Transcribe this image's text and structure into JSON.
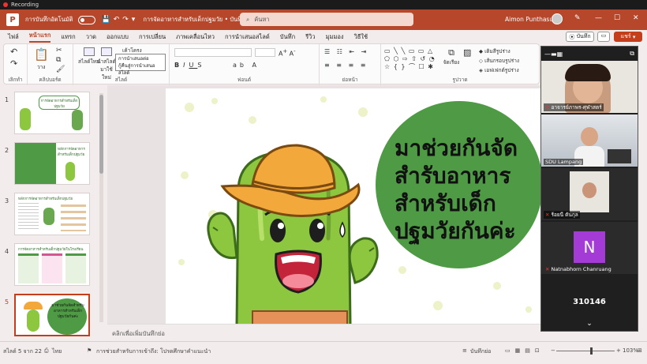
{
  "recording_label": "Recording",
  "titlebar": {
    "app_logo": "P",
    "autosave_label": "การบันทึกอัตโนมัติ",
    "doc_title": "การจัดอาหารสำหรับเด็กปฐมวัย • บันทึกไปยัง พีซีนี้",
    "search_placeholder": "ค้นหา",
    "user_name": "Aimon Punthasueb"
  },
  "tabs": [
    "ไฟล์",
    "หน้าแรก",
    "แทรก",
    "วาด",
    "ออกแบบ",
    "การเปลี่ยน",
    "ภาพเคลื่อนไหว",
    "การนำเสนอสไลด์",
    "บันทึก",
    "รีวิว",
    "มุมมอง",
    "วิธีใช้"
  ],
  "active_tab": "หน้าแรก",
  "tab_actions": {
    "record": "บันทึก",
    "share": "แชร์"
  },
  "ribbon": {
    "undo_label": "เลิกทำ",
    "paste_label": "วาง",
    "clipboard_label": "คลิปบอร์ด",
    "new_slide_label": "สไลด์ใหม่",
    "reuse_label": "นำสไลด์มาใช้ใหม่",
    "slides_label": "สไลด์",
    "layout_label": "เค้าโครง",
    "popup_line1": "การนำเสนอต่อ",
    "popup_line2": "กู้คืนสู่การนำเสนอสไลด์",
    "font_label": "ฟอนต์",
    "paragraph_label": "ย่อหน้า",
    "drawing_label": "รูปวาด",
    "arrange_label": "จัดเรียง",
    "shape_fill_label": "เติมสีรูปร่าง",
    "shape_outline_label": "เส้นกรอบรูปร่าง",
    "shape_effect_label": "เอฟเฟกต์รูปร่าง"
  },
  "thumbnails": [
    {
      "num": "1",
      "title": "การจัดอาหารสำหรับเด็กปฐมวัย"
    },
    {
      "num": "2",
      "title": "หลักการจัดอาหารสำหรับเด็กปฐมวัย"
    },
    {
      "num": "3",
      "title": "หลักการจัดอาหารสำหรับเด็กปฐมวัย"
    },
    {
      "num": "4",
      "title": "การจัดอาหารสำหรับเด็กปฐมวัยในโรงเรียน"
    },
    {
      "num": "5",
      "title": "มาช่วยกันจัดสำหรับอาหารสำหรับเด็กปฐมวัยกันค่ะ"
    }
  ],
  "active_thumb": "5",
  "slide": {
    "title_lines": [
      "มาช่วยกันจัด",
      "สำรับอาหาร",
      "สำหรับเด็ก",
      "ปฐมวัยกันค่ะ"
    ]
  },
  "notes_placeholder": "คลิกเพื่อเพิ่มบันทึกย่อ",
  "video": {
    "participants": [
      {
        "name": "อาจารย์ภาพร-ศุฬาสตร์",
        "muted": true
      },
      {
        "name": "SDU Lampang",
        "muted": false
      },
      {
        "name": "ร้อยนี ตันกุล",
        "muted": true
      },
      {
        "name": "Natnabhorn Chanruang",
        "muted": true,
        "initial": "N"
      }
    ],
    "meeting_id": "310146"
  },
  "status": {
    "slide_of": "สไลด์ 5 จาก 22",
    "language": "ไทย",
    "accessibility": "การช่วยสำหรับการเข้าถึง: โปรดศึกษาคำแนะนำ",
    "notes": "บันทึกย่อ",
    "zoom": "103%"
  },
  "colors": {
    "accent": "#b7472a",
    "share": "#c43e1c",
    "slide_green": "#4e9a45",
    "hat": "#f3a83c",
    "cactus": "#8dc63f"
  }
}
